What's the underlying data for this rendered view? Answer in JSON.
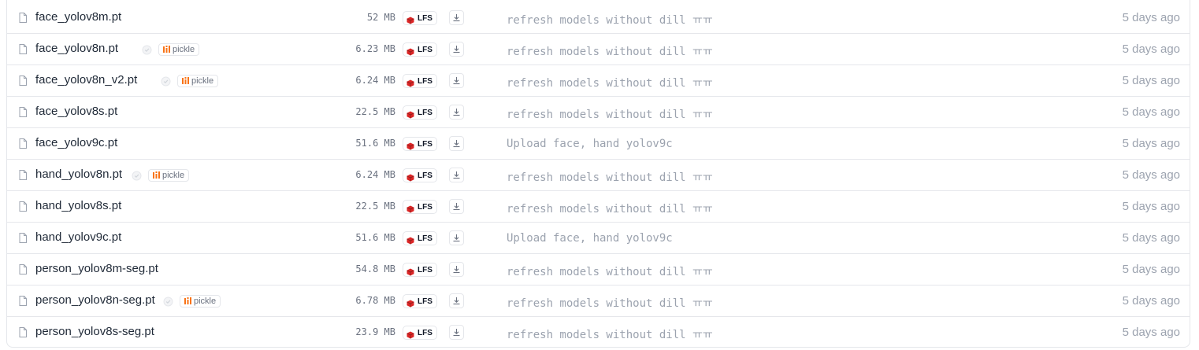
{
  "files": [
    {
      "name": "face_yolov8m.pt",
      "pickle": false,
      "size": "52 MB",
      "lfs": "LFS",
      "commit": "refresh models without dill ㅠㅠ",
      "date": "5 days ago"
    },
    {
      "name": "face_yolov8n.pt",
      "pickle": true,
      "pickle_label": "pickle",
      "size": "6.23 MB",
      "lfs": "LFS",
      "commit": "refresh models without dill ㅠㅠ",
      "date": "5 days ago"
    },
    {
      "name": "face_yolov8n_v2.pt",
      "pickle": true,
      "pickle_label": "pickle",
      "size": "6.24 MB",
      "lfs": "LFS",
      "commit": "refresh models without dill ㅠㅠ",
      "date": "5 days ago"
    },
    {
      "name": "face_yolov8s.pt",
      "pickle": false,
      "size": "22.5 MB",
      "lfs": "LFS",
      "commit": "refresh models without dill ㅠㅠ",
      "date": "5 days ago"
    },
    {
      "name": "face_yolov9c.pt",
      "pickle": false,
      "size": "51.6 MB",
      "lfs": "LFS",
      "commit": "Upload face, hand yolov9c",
      "date": "5 days ago"
    },
    {
      "name": "hand_yolov8n.pt",
      "pickle": true,
      "pickle_label": "pickle",
      "size": "6.24 MB",
      "lfs": "LFS",
      "commit": "refresh models without dill ㅠㅠ",
      "date": "5 days ago"
    },
    {
      "name": "hand_yolov8s.pt",
      "pickle": false,
      "size": "22.5 MB",
      "lfs": "LFS",
      "commit": "refresh models without dill ㅠㅠ",
      "date": "5 days ago"
    },
    {
      "name": "hand_yolov9c.pt",
      "pickle": false,
      "size": "51.6 MB",
      "lfs": "LFS",
      "commit": "Upload face, hand yolov9c",
      "date": "5 days ago"
    },
    {
      "name": "person_yolov8m-seg.pt",
      "pickle": false,
      "size": "54.8 MB",
      "lfs": "LFS",
      "commit": "refresh models without dill ㅠㅠ",
      "date": "5 days ago"
    },
    {
      "name": "person_yolov8n-seg.pt",
      "pickle": true,
      "pickle_label": "pickle",
      "size": "6.78 MB",
      "lfs": "LFS",
      "commit": "refresh models without dill ㅠㅠ",
      "date": "5 days ago"
    },
    {
      "name": "person_yolov8s-seg.pt",
      "pickle": false,
      "size": "23.9 MB",
      "lfs": "LFS",
      "commit": "refresh models without dill ㅠㅠ",
      "date": "5 days ago"
    }
  ],
  "icons": {
    "file": "file-icon",
    "shield": "shield-check-icon",
    "pickle": "pickle-icon",
    "lfs": "lfs-cube-icon",
    "download": "download-icon"
  },
  "colors": {
    "lfs_red": "#dc2626",
    "pickle_orange": "#f97316",
    "border": "#e5e7eb",
    "muted_text": "#9ca3af"
  }
}
